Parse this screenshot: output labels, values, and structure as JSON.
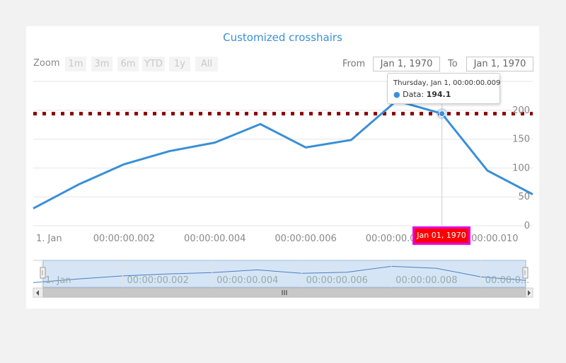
{
  "title": "Customized crosshairs",
  "zoom": {
    "label": "Zoom",
    "buttons": [
      "1m",
      "3m",
      "6m",
      "YTD",
      "1y",
      "All"
    ]
  },
  "range": {
    "from_label": "From",
    "from_value": "Jan 1, 1970",
    "to_label": "To",
    "to_value": "Jan 1, 1970"
  },
  "tooltip": {
    "date": "Thursday, Jan 1, 00:00:00.009",
    "series_label": "Data:",
    "value": "194.1"
  },
  "crosshair_label": "Jan 01, 1970",
  "colors": {
    "line": "#3a8fd6",
    "plotline": "#8b0000",
    "crosshair_label_bg": "#ff0000",
    "crosshair_label_border": "#e600e6"
  },
  "chart_data": {
    "type": "line",
    "title": "Customized crosshairs",
    "x": [
      0,
      1,
      2,
      3,
      4,
      5,
      6,
      7,
      8,
      9,
      10,
      11
    ],
    "series": [
      {
        "values": [
          29.9,
          71.5,
          106.4,
          129.2,
          144.0,
          176.0,
          135.6,
          148.5,
          216.4,
          194.1,
          95.6,
          54.4
        ]
      }
    ],
    "x_tick_labels": [
      "1. Jan",
      "00:00:00.002",
      "00:00:00.004",
      "00:00:00.006",
      "00:00:00.008",
      "00:00:00.010"
    ],
    "x_tick_values": [
      0,
      2,
      4,
      6,
      8,
      10
    ],
    "y_tick_labels": [
      "0",
      "50",
      "100",
      "150",
      "200"
    ],
    "y_tick_values": [
      0,
      50,
      100,
      150,
      200
    ],
    "ylim": [
      0,
      250
    ],
    "plot_line_y": 194.1,
    "crosshair_x": 9,
    "navigator_tick_labels": [
      "1. Jan",
      "00:00:00.002",
      "00:00:00.004",
      "00:00:00.006",
      "00:00:00.008",
      "00:00:0..."
    ],
    "grid": true
  }
}
